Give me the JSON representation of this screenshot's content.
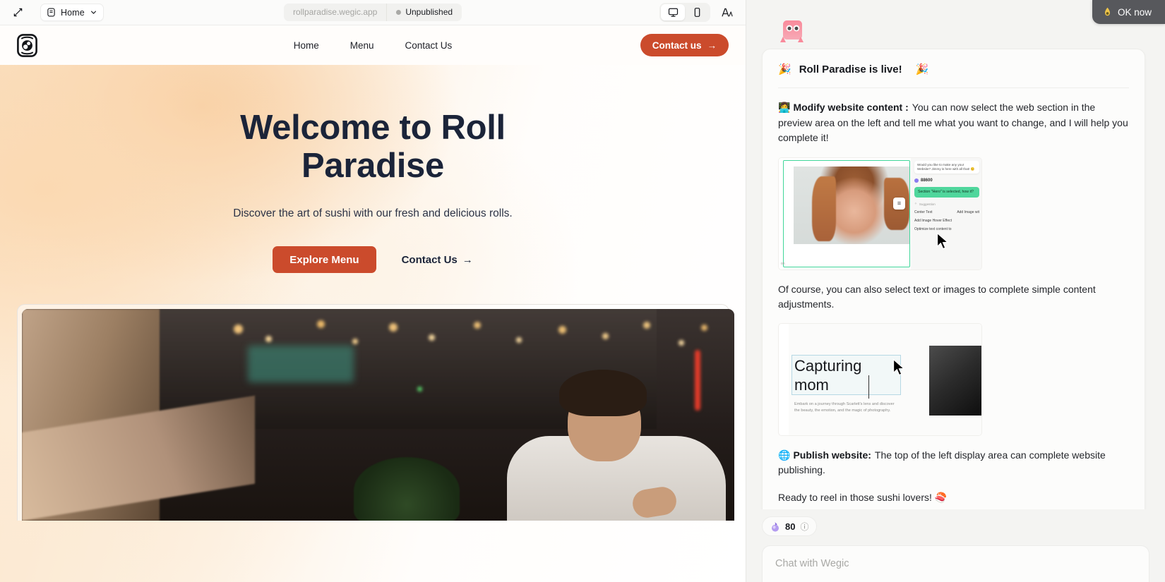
{
  "toolbar": {
    "collapse_icon": "collapse-arrow-icon",
    "page_icon": "page-icon",
    "page_label": "Home",
    "chevron": "chevron-down-icon",
    "url": "rollparadise.wegic.app",
    "publish_status": "Unpublished",
    "desktop_icon": "desktop-icon",
    "mobile_icon": "mobile-icon",
    "font_icon": "font-size-icon",
    "font_glyph": "A"
  },
  "site": {
    "logo_name": "sushi-roll-logo",
    "nav": [
      {
        "label": "Home"
      },
      {
        "label": "Menu"
      },
      {
        "label": "Contact Us"
      }
    ],
    "header_cta": "Contact us",
    "header_cta_arrow": "→",
    "hero": {
      "title": "Welcome to Roll Paradise",
      "subtitle": "Discover the art of sushi with our fresh and delicious rolls.",
      "primary_cta": "Explore Menu",
      "secondary_cta": "Contact Us",
      "secondary_arrow": "→"
    },
    "accent_color": "#cb4b2c",
    "heading_color": "#1b2439"
  },
  "chat": {
    "ok_now_label": "OK now",
    "ok_now_icon": "flame-icon",
    "mascot_name": "wegic-mascot",
    "header_emoji_left": "🎉",
    "header_title": "Roll Paradise is live!",
    "header_emoji_right": "🎉",
    "messages": [
      {
        "emoji": "👩‍💻",
        "bold": "Modify website content :",
        "text": "You can now select the web section in the preview area on the left and tell me what you want to change, and I will help you complete it!"
      },
      {
        "emoji": "",
        "bold": "",
        "text": "Of course, you can also select text or images to complete simple content adjustments."
      },
      {
        "emoji": "🌐",
        "bold": "Publish website:",
        "text": "The top of the left display area can complete website publishing."
      },
      {
        "emoji": "",
        "bold": "",
        "text": "Ready to reel in those sushi lovers! 🍣"
      }
    ],
    "demo1": {
      "name": "section-select-demo",
      "bubble_text": "Would you like to make any your Website? Jimmy is here with all that! 😊",
      "coins": "88600",
      "green_text": "Section \"Hero\" is selected, how it?",
      "suggestion_label": "Suggestion",
      "options": [
        "Center Text",
        "Add Image wit",
        "Add Image Hover Effect",
        "Optimize text content to"
      ],
      "badge_icon": "menu-handle-icon"
    },
    "demo2": {
      "name": "text-edit-demo",
      "heading": "Capturing mom",
      "body": "Embark on a journey through Scarlett's lens and discover the beauty, the emotion, and the magic of photography."
    },
    "token_icon": "gem-icon",
    "token_count": "80",
    "token_info_icon": "info-icon",
    "input_placeholder": "Chat with Wegic"
  }
}
